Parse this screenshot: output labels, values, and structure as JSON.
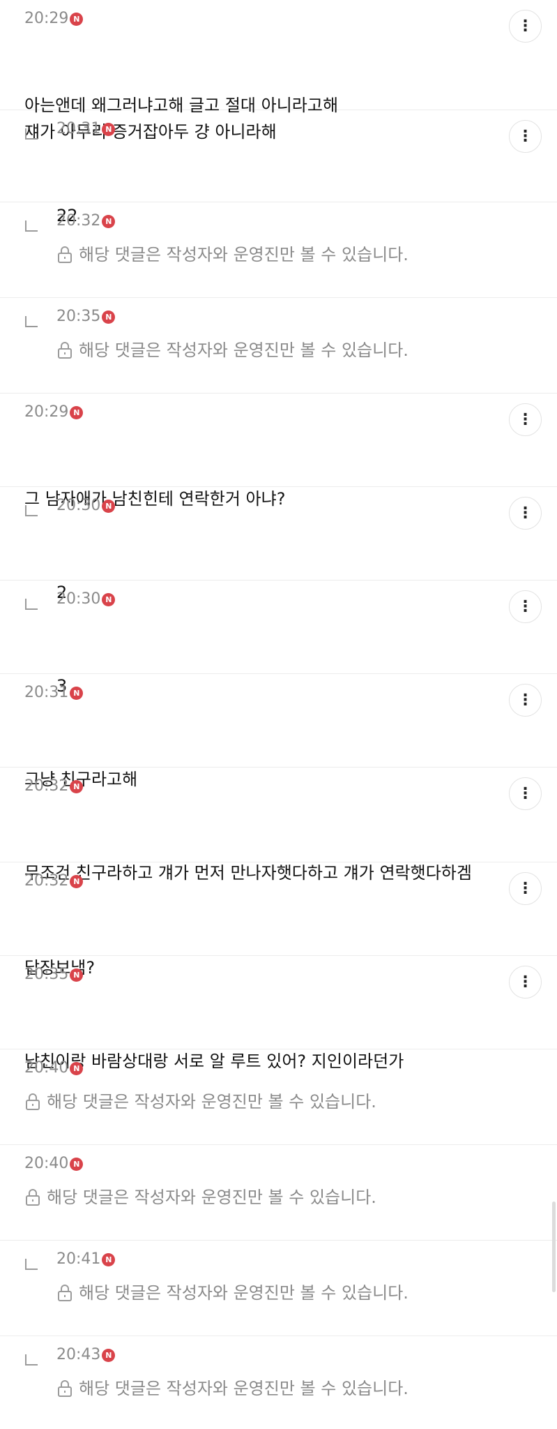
{
  "badge_letter": "N",
  "colors": {
    "badge": "#d9434a",
    "time": "#8a8a8a",
    "divider": "#ececec"
  },
  "comments": [
    {
      "time": "20:29",
      "reply": false,
      "locked": false,
      "more": true,
      "text": "아는앤데 왜그러냐고해 글고 절대 아니라고해\n쟤가 아무리 증거잡아두 걍 아니라해"
    },
    {
      "time": "20:31",
      "reply": true,
      "locked": false,
      "more": true,
      "text": "22"
    },
    {
      "time": "20:32",
      "reply": true,
      "locked": true,
      "more": false,
      "text": "해당 댓글은 작성자와 운영진만 볼 수 있습니다."
    },
    {
      "time": "20:35",
      "reply": true,
      "locked": true,
      "more": false,
      "text": "해당 댓글은 작성자와 운영진만 볼 수 있습니다."
    },
    {
      "time": "20:29",
      "reply": false,
      "locked": false,
      "more": true,
      "text": "그 남자애가 남친힌테 연락한거 아냐?"
    },
    {
      "time": "20:30",
      "reply": true,
      "locked": false,
      "more": true,
      "text": "2"
    },
    {
      "time": "20:30",
      "reply": true,
      "locked": false,
      "more": true,
      "text": "3"
    },
    {
      "time": "20:31",
      "reply": false,
      "locked": false,
      "more": true,
      "text": "그냥 친구라고해"
    },
    {
      "time": "20:32",
      "reply": false,
      "locked": false,
      "more": true,
      "text": "무조건 친구라하고 걔가 먼저 만나자햇다하고 걔가 연락햇다하겜"
    },
    {
      "time": "20:32",
      "reply": false,
      "locked": false,
      "more": true,
      "text": "답장보냄?"
    },
    {
      "time": "20:35",
      "reply": false,
      "locked": false,
      "more": true,
      "text": "남친이랑 바람상대랑 서로 알 루트 있어? 지인이라던가"
    },
    {
      "time": "20:40",
      "reply": false,
      "locked": true,
      "more": false,
      "text": "해당 댓글은 작성자와 운영진만 볼 수 있습니다."
    },
    {
      "time": "20:40",
      "reply": false,
      "locked": true,
      "more": false,
      "text": "해당 댓글은 작성자와 운영진만 볼 수 있습니다."
    },
    {
      "time": "20:41",
      "reply": true,
      "locked": true,
      "more": false,
      "text": "해당 댓글은 작성자와 운영진만 볼 수 있습니다."
    },
    {
      "time": "20:43",
      "reply": true,
      "locked": true,
      "more": false,
      "text": "해당 댓글은 작성자와 운영진만 볼 수 있습니다."
    }
  ]
}
